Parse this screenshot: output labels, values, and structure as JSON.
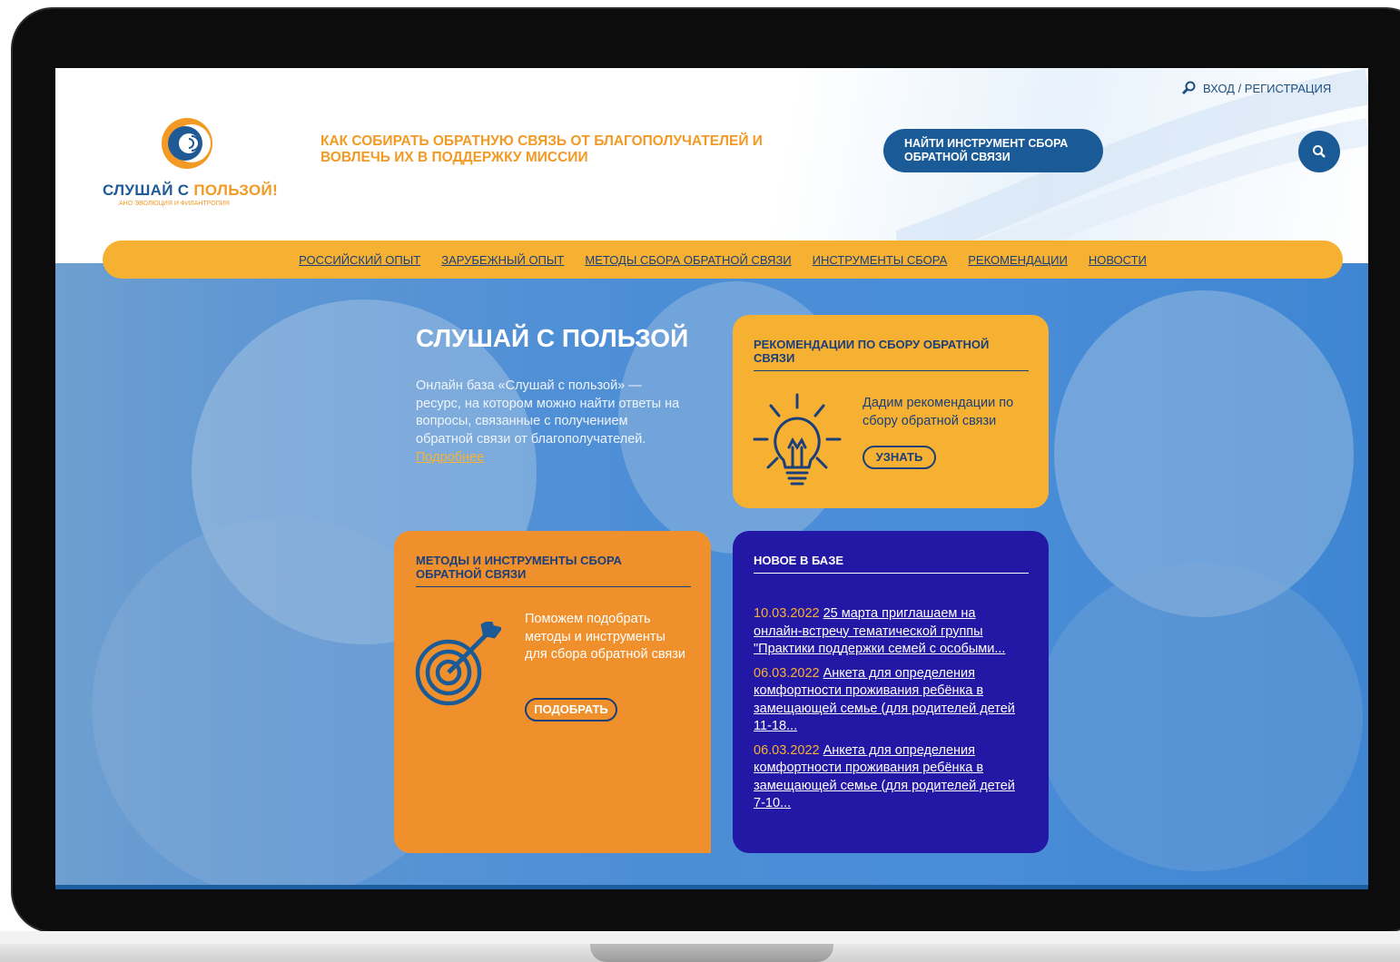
{
  "header": {
    "logo_text_main": "СЛУШАЙ С ",
    "logo_text_accent": "ПОЛЬЗОЙ!",
    "logo_sub": "АНО ЭВОЛЮЦИЯ И ФИЛАНТРОПИЯ",
    "tagline": "Как собирать обратную связь от благополучателей и вовлечь их в поддержку миссии",
    "find_button": "Найти инструмент сбора обратной связи",
    "login_label": "Вход / Регистрация",
    "search_icon": "search-icon",
    "login_icon": "search-icon"
  },
  "nav": {
    "items": [
      {
        "label": "Российский опыт"
      },
      {
        "label": "Зарубежный опыт"
      },
      {
        "label": "Методы сбора обратной связи"
      },
      {
        "label": "Инструменты сбора"
      },
      {
        "label": "Рекомендации"
      },
      {
        "label": "Новости"
      }
    ]
  },
  "hero": {
    "title": "Слушай с пользой",
    "text": "Онлайн база «Слушай с пользой» — ресурс, на котором можно найти ответы на вопросы, связанные с получением обратной связи от благополучателей.",
    "more_link": "Подробнее"
  },
  "recommend_card": {
    "title": "Рекомендации по сбору обратной связи",
    "text": "Дадим рекомендации по сбору обратной связи",
    "button": "Узнать",
    "icon": "lightbulb-icon"
  },
  "methods_card": {
    "title": "Методы и инструменты сбора обратной связи",
    "text": "Поможем подобрать методы и инструменты для сбора обратной связи",
    "button": "Подобрать",
    "icon": "target-icon"
  },
  "news_card": {
    "title": "Новое в базе",
    "items": [
      {
        "date": "10.03.2022",
        "text": "25 марта приглашаем на онлайн-встречу тематической группы \"Практики поддержки семей с особыми..."
      },
      {
        "date": "06.03.2022",
        "text": "Анкета для определения комфортности проживания ребёнка в замещающей семье (для родителей детей 11-18..."
      },
      {
        "date": "06.03.2022",
        "text": "Анкета для определения комфортности проживания ребёнка в замещающей семье (для родителей детей 7-10..."
      }
    ]
  },
  "colors": {
    "brand_blue": "#1a5a96",
    "orange": "#f39a25",
    "yellow": "#f6b133",
    "news_blue": "#2318a6"
  }
}
